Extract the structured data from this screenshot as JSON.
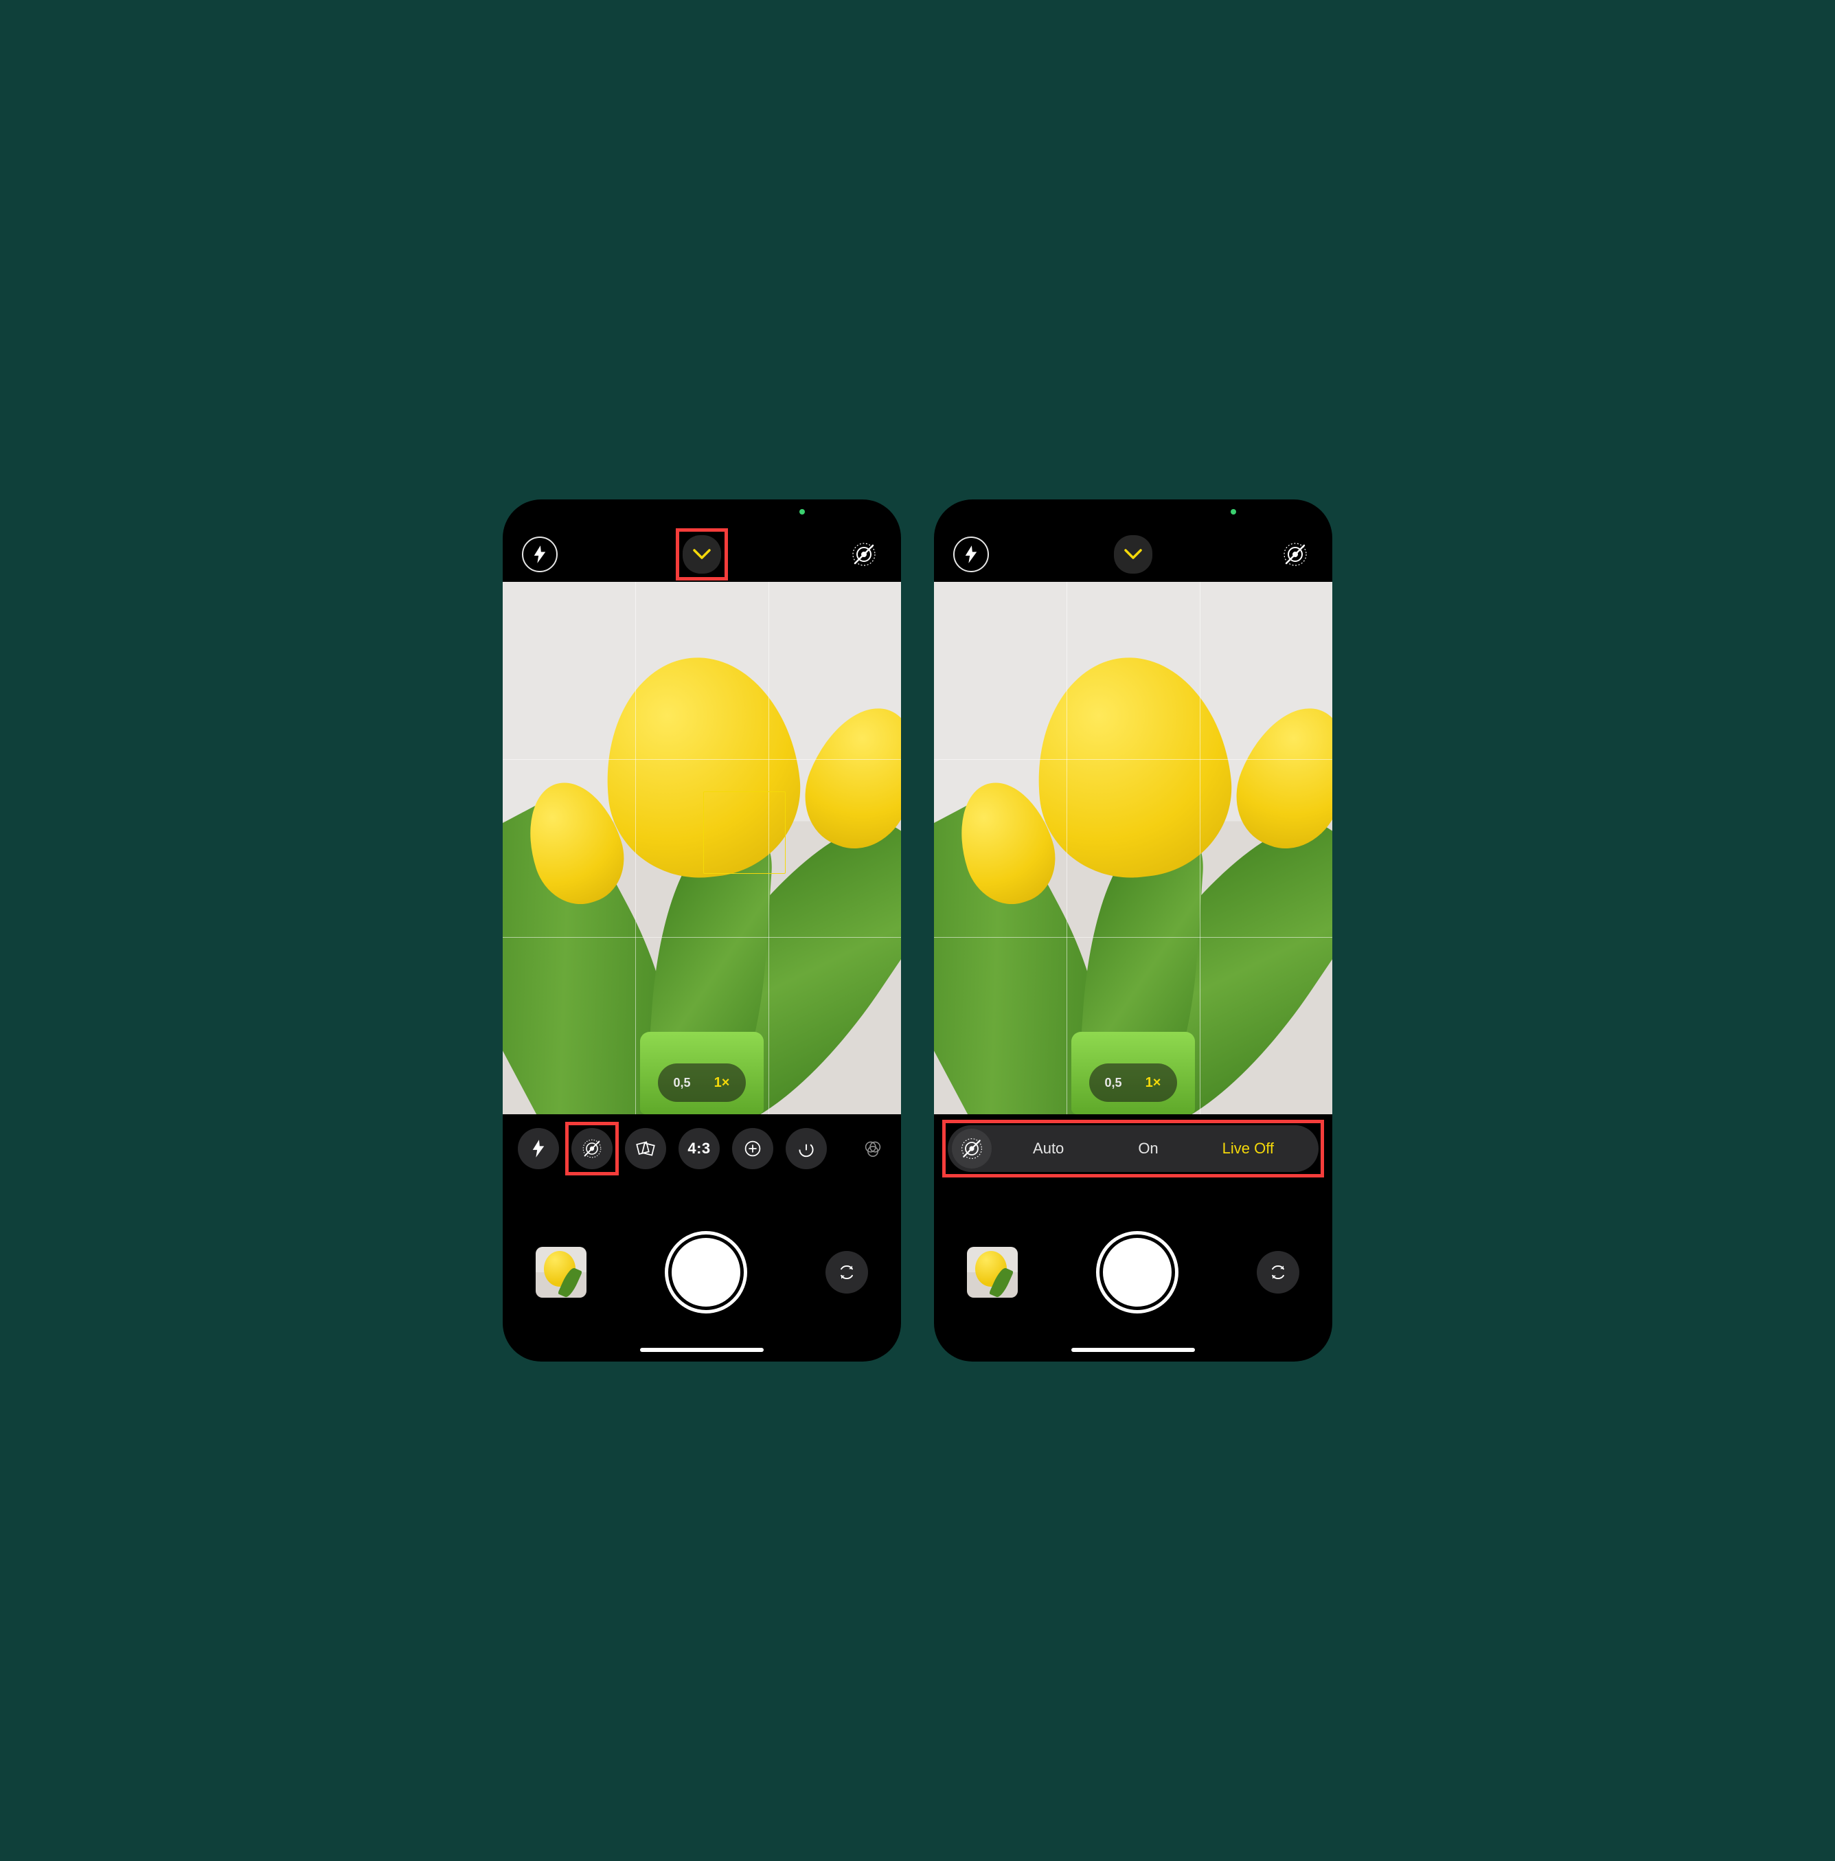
{
  "left": {
    "zoom": {
      "wide": "0,5",
      "main": "1×"
    },
    "tools": {
      "aspect": "4:3"
    }
  },
  "right": {
    "zoom": {
      "wide": "0,5",
      "main": "1×"
    },
    "live": {
      "auto": "Auto",
      "on": "On",
      "off": "Live Off"
    }
  }
}
